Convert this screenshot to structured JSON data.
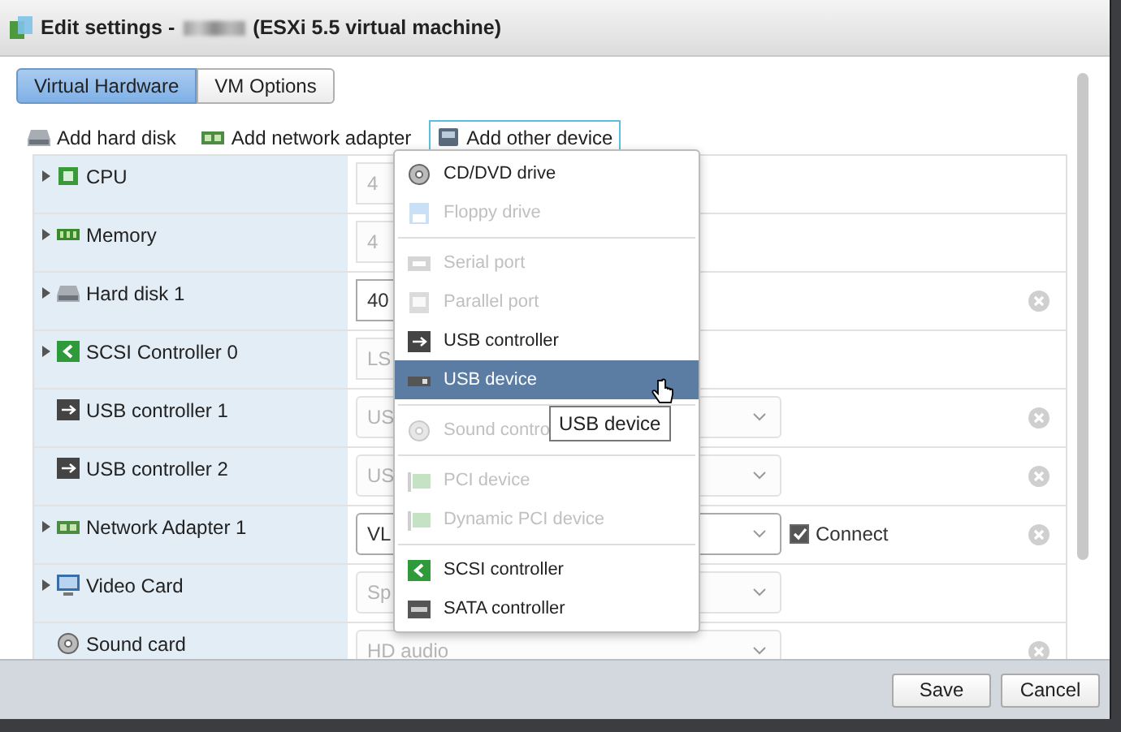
{
  "window": {
    "title_prefix": "Edit settings -",
    "title_suffix": "(ESXi 5.5 virtual machine)"
  },
  "tabs": [
    {
      "label": "Virtual Hardware",
      "selected": true
    },
    {
      "label": "VM Options",
      "selected": false
    }
  ],
  "toolbar": [
    {
      "label": "Add hard disk",
      "kind": "disk",
      "active": false
    },
    {
      "label": "Add network adapter",
      "kind": "network",
      "active": false
    },
    {
      "label": "Add other device",
      "kind": "device",
      "active": true
    }
  ],
  "rows": [
    {
      "label": "CPU",
      "kind": "cpu",
      "expandable": true,
      "field": {
        "kind": "input",
        "value": "4",
        "disabled": true
      },
      "removable": false
    },
    {
      "label": "Memory",
      "kind": "memory",
      "expandable": true,
      "field": {
        "kind": "input",
        "value": "4",
        "disabled": true
      },
      "removable": false
    },
    {
      "label": "Hard disk 1",
      "kind": "disk",
      "expandable": true,
      "field": {
        "kind": "input",
        "value": "40",
        "disabled": false
      },
      "removable": true
    },
    {
      "label": "SCSI Controller 0",
      "kind": "scsi",
      "expandable": true,
      "field": {
        "kind": "input",
        "value": "LS",
        "disabled": true
      },
      "removable": false
    },
    {
      "label": "USB controller 1",
      "kind": "usb",
      "expandable": false,
      "field": {
        "kind": "select",
        "value": "US",
        "disabled": true
      },
      "removable": true
    },
    {
      "label": "USB controller 2",
      "kind": "usb",
      "expandable": false,
      "field": {
        "kind": "select",
        "value": "US",
        "disabled": true
      },
      "removable": true
    },
    {
      "label": "Network Adapter 1",
      "kind": "network",
      "expandable": true,
      "field": {
        "kind": "select",
        "value": "VL",
        "disabled": false
      },
      "removable": true,
      "connect": {
        "label": "Connect",
        "checked": true
      }
    },
    {
      "label": "Video Card",
      "kind": "video",
      "expandable": true,
      "field": {
        "kind": "select",
        "value": "Sp",
        "disabled": true
      },
      "removable": false
    },
    {
      "label": "Sound card",
      "kind": "sound",
      "expandable": false,
      "field": {
        "kind": "select",
        "value": "HD audio",
        "disabled": true
      },
      "removable": true
    }
  ],
  "menu": {
    "groups": [
      [
        {
          "label": "CD/DVD drive",
          "kind": "cd",
          "disabled": false,
          "selected": false
        },
        {
          "label": "Floppy drive",
          "kind": "floppy",
          "disabled": true,
          "selected": false
        }
      ],
      [
        {
          "label": "Serial port",
          "kind": "serial",
          "disabled": true,
          "selected": false
        },
        {
          "label": "Parallel port",
          "kind": "parallel",
          "disabled": true,
          "selected": false
        },
        {
          "label": "USB controller",
          "kind": "usb",
          "disabled": false,
          "selected": false
        },
        {
          "label": "USB device",
          "kind": "usbdev",
          "disabled": false,
          "selected": true
        }
      ],
      [
        {
          "label": "Sound contro",
          "kind": "sound",
          "disabled": true,
          "selected": false
        }
      ],
      [
        {
          "label": "PCI device",
          "kind": "pci",
          "disabled": true,
          "selected": false
        },
        {
          "label": "Dynamic PCI device",
          "kind": "pci",
          "disabled": true,
          "selected": false
        }
      ],
      [
        {
          "label": "SCSI controller",
          "kind": "scsi",
          "disabled": false,
          "selected": false
        },
        {
          "label": "SATA controller",
          "kind": "sata",
          "disabled": false,
          "selected": false
        }
      ]
    ],
    "tooltip": "USB device"
  },
  "buttons": [
    {
      "label": "Save"
    },
    {
      "label": "Cancel"
    }
  ]
}
